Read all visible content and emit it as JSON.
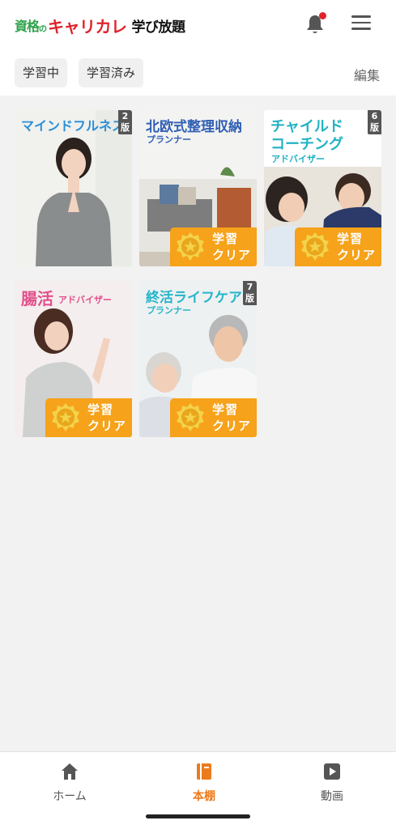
{
  "header": {
    "logo_shikaku": "資格",
    "logo_no": "の",
    "logo_brand": "キャリカレ",
    "logo_service": "学び放題",
    "bell_icon": "bell-icon",
    "menu_icon": "hamburger-menu-icon",
    "colors": {
      "brand_red": "#e0232a",
      "brand_green": "#2ea24a"
    }
  },
  "filters": {
    "chip_studying": "学習中",
    "chip_completed": "学習済み",
    "edit_label": "編集"
  },
  "courses": [
    {
      "title": "マインドフルネス",
      "subtitle": "",
      "edition_num": "2",
      "edition_suffix": "版",
      "cleared": false,
      "title_color": "#2a8fd6"
    },
    {
      "title": "北欧式整理収納",
      "subtitle": "プランナー",
      "edition_num": "",
      "edition_suffix": "",
      "cleared": true,
      "title_color": "#2f5fb5"
    },
    {
      "title": "チャイルド",
      "title2": "コーチング",
      "subtitle": "アドバイザー",
      "edition_num": "6",
      "edition_suffix": "版",
      "cleared": true,
      "title_color": "#20b2c4"
    },
    {
      "title": "腸活",
      "subtitle": "アドバイザー",
      "edition_num": "",
      "edition_suffix": "",
      "cleared": true,
      "title_color": "#e24f8a"
    },
    {
      "title": "終活ライフケア",
      "subtitle": "プランナー",
      "edition_num": "7",
      "edition_suffix": "版",
      "cleared": true,
      "title_color": "#27b5c9"
    }
  ],
  "clear_badge": {
    "line1": "学習",
    "line2": "クリア",
    "color": "#f6a21a"
  },
  "bottom_nav": {
    "home": "ホーム",
    "bookshelf": "本棚",
    "video": "動画",
    "active_color": "#ec7b1d"
  }
}
